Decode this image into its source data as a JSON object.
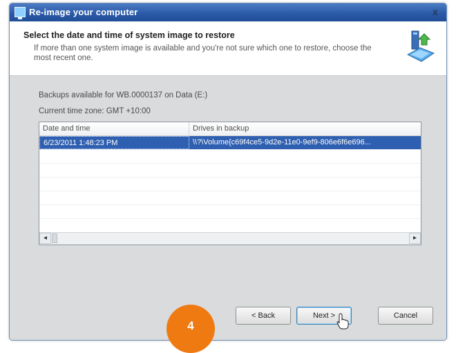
{
  "window": {
    "title": "Re-image your computer",
    "close_label": "x",
    "icon": "computer-icon"
  },
  "header": {
    "title": "Select the date and time of system image to restore",
    "description": "If more than one system image is available and you're not sure which one to restore, choose the most recent one.",
    "illustration": "computer-restore-illustration"
  },
  "content": {
    "backups_label": "Backups available for WB.0000137 on Data (E:)",
    "timezone_label": "Current time zone: GMT +10:00",
    "table": {
      "columns": [
        "Date and time",
        "Drives in backup"
      ],
      "rows": [
        {
          "date": "6/23/2011 1:48:23 PM",
          "drives": "\\\\?\\Volume{c69f4ce5-9d2e-11e0-9ef9-806e6f6e696...",
          "selected": true
        }
      ]
    },
    "scroll_left": "◂",
    "scroll_right": "▸"
  },
  "footer": {
    "back_label": "< Back",
    "next_label": "Next >",
    "cancel_label": "Cancel"
  },
  "overlay": {
    "step_number": "4"
  },
  "colors": {
    "selection": "#2f5fb0",
    "title_bar": "#2c5aa8",
    "step_badge": "#f07a12"
  }
}
